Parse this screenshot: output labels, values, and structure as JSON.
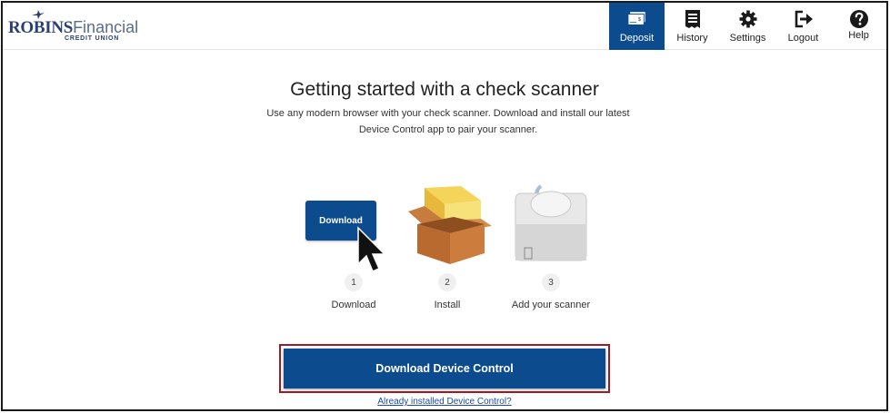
{
  "brand": {
    "name_bold": "ROBINS",
    "name_light": "Financial",
    "tagline": "CREDIT UNION"
  },
  "nav": {
    "deposit": {
      "label": "Deposit",
      "icon": "check-deposit-icon",
      "active": true
    },
    "history": {
      "label": "History",
      "icon": "receipt-icon"
    },
    "settings": {
      "label": "Settings",
      "icon": "gear-icon"
    },
    "logout": {
      "label": "Logout",
      "icon": "logout-icon"
    },
    "help": {
      "label": "Help",
      "icon": "question-circle-icon"
    }
  },
  "main": {
    "title": "Getting started with a check scanner",
    "subtitle": "Use any modern browser with your check scanner. Download and install our latest Device Control app to pair your scanner.",
    "steps": [
      {
        "number": "1",
        "label": "Download",
        "button_text": "Download"
      },
      {
        "number": "2",
        "label": "Install"
      },
      {
        "number": "3",
        "label": "Add your scanner"
      }
    ],
    "download_button": "Download Device Control",
    "already_installed_link": "Already installed Device Control?"
  },
  "colors": {
    "primary": "#0d4b8f",
    "highlight_border": "#9b1c26",
    "link": "#1a4ca8"
  }
}
